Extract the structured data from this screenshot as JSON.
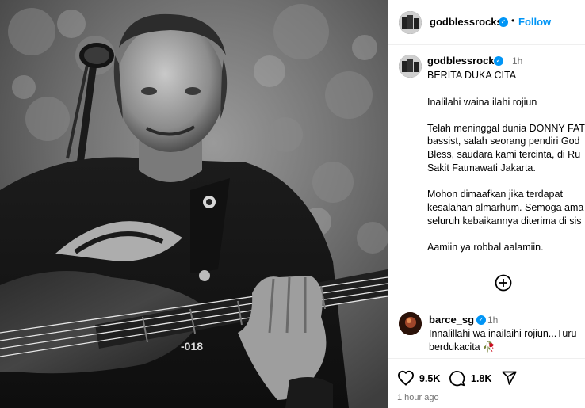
{
  "post": {
    "username": "godblessrocks",
    "follow_label": "Follow",
    "dot": "•"
  },
  "caption": {
    "username": "godblessrocks",
    "time": "1h",
    "lines": [
      "BERITA DUKA  CITA",
      "Inalilahi waina ilahi rojiun",
      "Telah meninggal dunia DONNY FAT",
      "bassist, salah seorang pendiri God",
      "Bless, saudara kami tercinta, di  Ru",
      "Sakit Fatmawati Jakarta.",
      "Mohon dimaafkan jika terdapat",
      "kesalahan almarhum. Semoga ama",
      "seluruh kebaikannya diterima di sis",
      "Aamiin ya robbal aalamiin."
    ]
  },
  "comment": {
    "username": "barce_sg",
    "time": "1h",
    "lines": [
      "Innalillahi wa inailaihi rojiun...Turu",
      "berdukacita 🥀"
    ]
  },
  "actions": {
    "likes": "9.5K",
    "comments": "1.8K",
    "posted_ago": "1 hour ago"
  },
  "photo": {
    "shirt_text": "-018"
  },
  "colors": {
    "accent_blue": "#0095f6",
    "muted_gray": "#737373",
    "divider": "#dbdbdb"
  },
  "icons": [
    "verified-badge-icon",
    "add-circle-icon",
    "heart-icon",
    "comment-icon",
    "share-icon"
  ]
}
